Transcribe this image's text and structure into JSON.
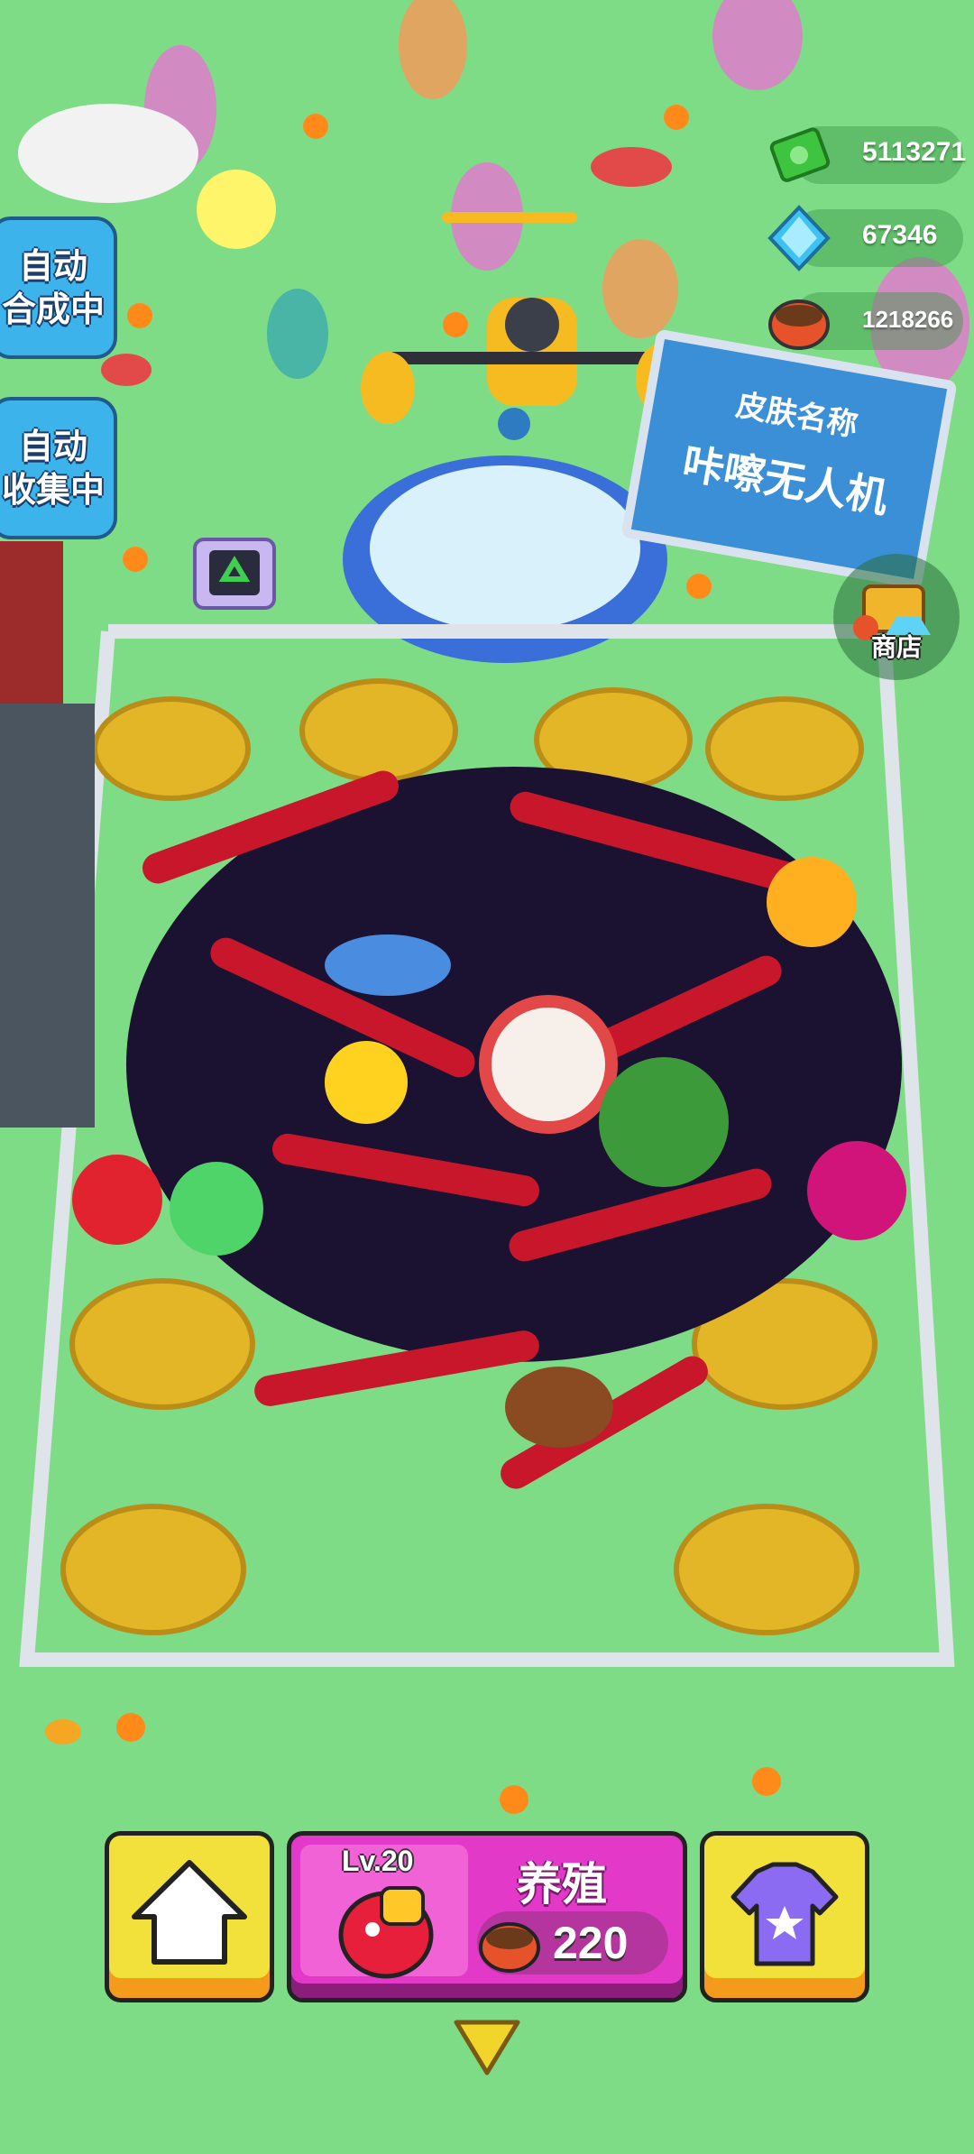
{
  "hud": {
    "cash": "5113271",
    "gems": "67346",
    "food": "1218266"
  },
  "side_buttons": {
    "auto_merge": "自动\n合成中",
    "auto_collect": "自动\n收集中"
  },
  "sign": {
    "line1": "皮肤名称",
    "line2": "咔嚓无人机"
  },
  "shop": {
    "label": "商店"
  },
  "bottom_bar": {
    "level": "Lv.20",
    "breed_label": "养殖",
    "breed_cost": "220"
  },
  "colors": {
    "grass": "#7fdc86",
    "button_yellow": "#f2e13a",
    "button_magenta": "#e339c8",
    "side_button_blue": "#3cb3ea"
  },
  "icons": [
    "cash-icon",
    "gem-icon",
    "food-bowl-icon",
    "recycle-icon",
    "drone-icon",
    "shop-chest-icon",
    "home-icon",
    "shirt-icon",
    "pet-icon",
    "chevron-down-icon"
  ]
}
